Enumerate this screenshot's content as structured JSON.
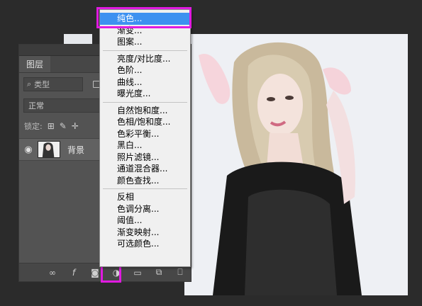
{
  "layers_panel": {
    "tab_label": "图层",
    "filter_label": "类型",
    "blend_mode": "正常",
    "lock_label": "锁定:",
    "layer": {
      "name": "背景"
    }
  },
  "adjustment_menu": {
    "groups": [
      [
        "纯色...",
        "渐变...",
        "图案..."
      ],
      [
        "亮度/对比度...",
        "色阶...",
        "曲线...",
        "曝光度..."
      ],
      [
        "自然饱和度...",
        "色相/饱和度...",
        "色彩平衡...",
        "黑白...",
        "照片滤镜...",
        "通道混合器...",
        "颜色查找..."
      ],
      [
        "反相",
        "色调分离...",
        "阈值...",
        "渐变映射...",
        "可选颜色..."
      ]
    ],
    "selected": "纯色..."
  },
  "colors": {
    "highlight": "#e01ae0",
    "menu_selected": "#3d91f0"
  },
  "icons": {
    "footer": [
      "link-icon",
      "fx-icon",
      "mask-icon",
      "adjustment-layer-icon",
      "group-icon",
      "new-layer-icon",
      "trash-icon"
    ]
  }
}
